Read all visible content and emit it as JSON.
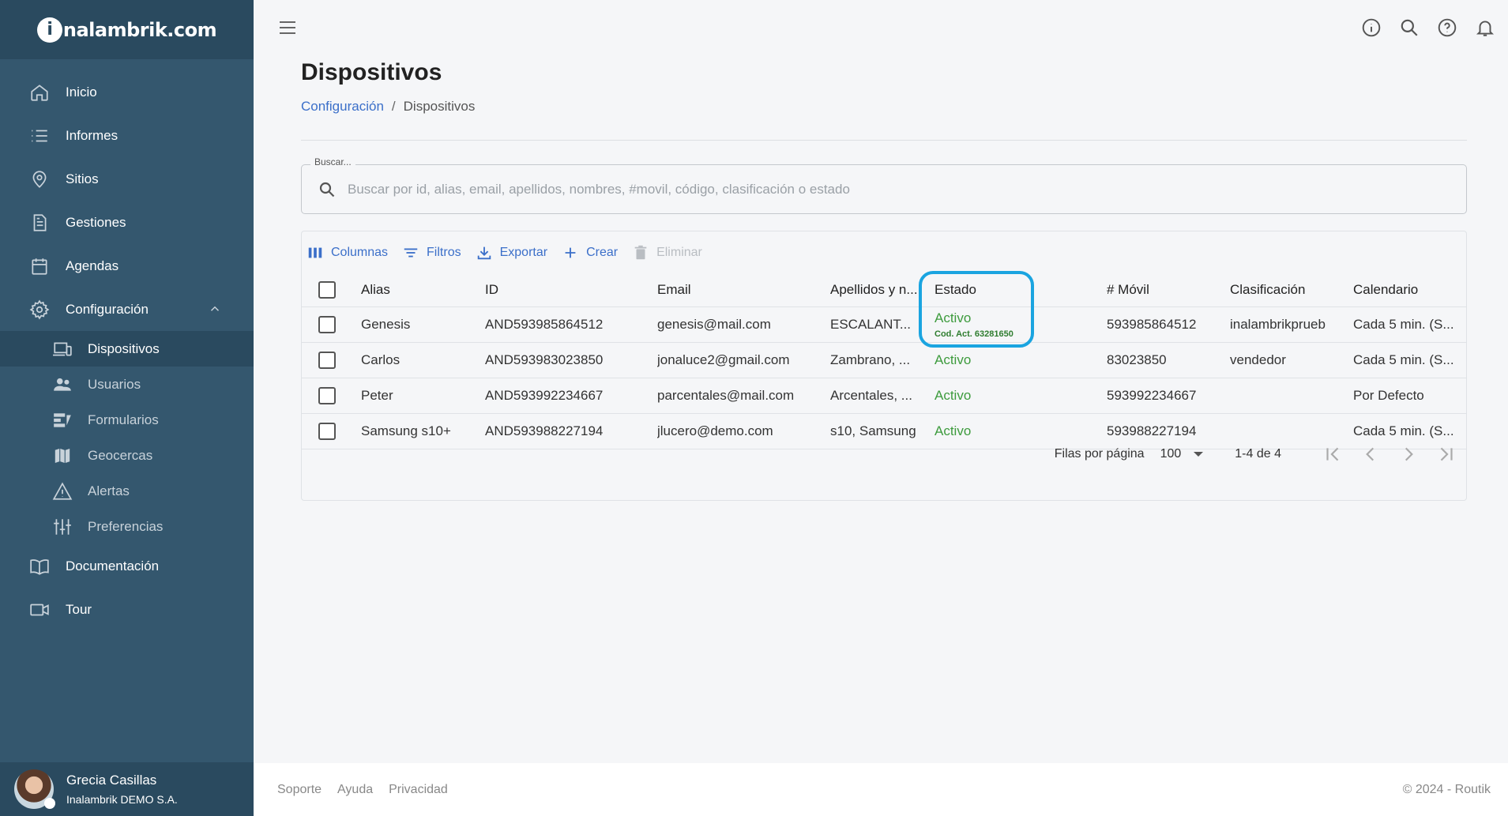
{
  "brand": {
    "logo_prefix": "i",
    "logo_text": "nalambrik.com"
  },
  "sidebar": {
    "items": [
      {
        "label": "Inicio",
        "icon": "home-icon"
      },
      {
        "label": "Informes",
        "icon": "list-icon"
      },
      {
        "label": "Sitios",
        "icon": "location-pin-icon"
      },
      {
        "label": "Gestiones",
        "icon": "document-icon"
      },
      {
        "label": "Agendas",
        "icon": "calendar-icon"
      },
      {
        "label": "Configuración",
        "icon": "gear-icon",
        "expanded": true
      }
    ],
    "subitems": [
      {
        "label": "Dispositivos",
        "icon": "devices-icon",
        "active": true
      },
      {
        "label": "Usuarios",
        "icon": "users-icon"
      },
      {
        "label": "Formularios",
        "icon": "form-icon"
      },
      {
        "label": "Geocercas",
        "icon": "map-icon"
      },
      {
        "label": "Alertas",
        "icon": "warning-icon"
      },
      {
        "label": "Preferencias",
        "icon": "sliders-icon"
      }
    ],
    "bottom_items": [
      {
        "label": "Documentación",
        "icon": "book-icon"
      },
      {
        "label": "Tour",
        "icon": "video-icon"
      }
    ],
    "user": {
      "name": "Grecia Casillas",
      "company": "Inalambrik DEMO S.A."
    }
  },
  "page": {
    "title": "Dispositivos",
    "breadcrumb": {
      "parent": "Configuración",
      "separator": "/",
      "current": "Dispositivos"
    }
  },
  "search": {
    "legend": "Buscar...",
    "placeholder": "Buscar por id, alias, email, apellidos, nombres, #movil, código, clasificación o estado",
    "value": ""
  },
  "toolbar": {
    "columns": "Columnas",
    "filters": "Filtros",
    "export": "Exportar",
    "create": "Crear",
    "delete": "Eliminar"
  },
  "table": {
    "headers": {
      "alias": "Alias",
      "id": "ID",
      "email": "Email",
      "apellidos": "Apellidos y n...",
      "estado": "Estado",
      "movil": "# Móvil",
      "clasificacion": "Clasificación",
      "calendario": "Calendario"
    },
    "rows": [
      {
        "alias": "Genesis",
        "id": "AND593985864512",
        "email": "genesis@mail.com",
        "apellidos": "ESCALANT...",
        "estado": "Activo",
        "codact": "Cod. Act. 63281650",
        "movil": "593985864512",
        "clasificacion": "inalambrikprueb",
        "calendario": "Cada 5 min. (S..."
      },
      {
        "alias": "Carlos",
        "id": "AND593983023850",
        "email": "jonaluce2@gmail.com",
        "apellidos": "Zambrano, ...",
        "estado": "Activo",
        "movil": "83023850",
        "clasificacion": "vendedor",
        "calendario": "Cada 5 min. (S..."
      },
      {
        "alias": "Peter",
        "id": "AND593992234667",
        "email": "parcentales@mail.com",
        "apellidos": "Arcentales, ...",
        "estado": "Activo",
        "movil": "593992234667",
        "clasificacion": "",
        "calendario": "Por Defecto"
      },
      {
        "alias": "Samsung s10+",
        "id": "AND593988227194",
        "email": "jlucero@demo.com",
        "apellidos": "s10, Samsung",
        "estado": "Activo",
        "movil": "593988227194",
        "clasificacion": "",
        "calendario": "Cada 5 min. (S..."
      }
    ]
  },
  "pagination": {
    "rows_label": "Filas por página",
    "rows_value": "100",
    "range": "1-4 de 4"
  },
  "footer": {
    "links": [
      "Soporte",
      "Ayuda",
      "Privacidad"
    ],
    "copyright": "© 2024 - Routik"
  },
  "colors": {
    "sidebar": "#34576e",
    "sidebar_dark": "#2a4a5f",
    "accent": "#3b6fc9",
    "active_green": "#3d9b3d",
    "highlight": "#1aa4e0"
  }
}
